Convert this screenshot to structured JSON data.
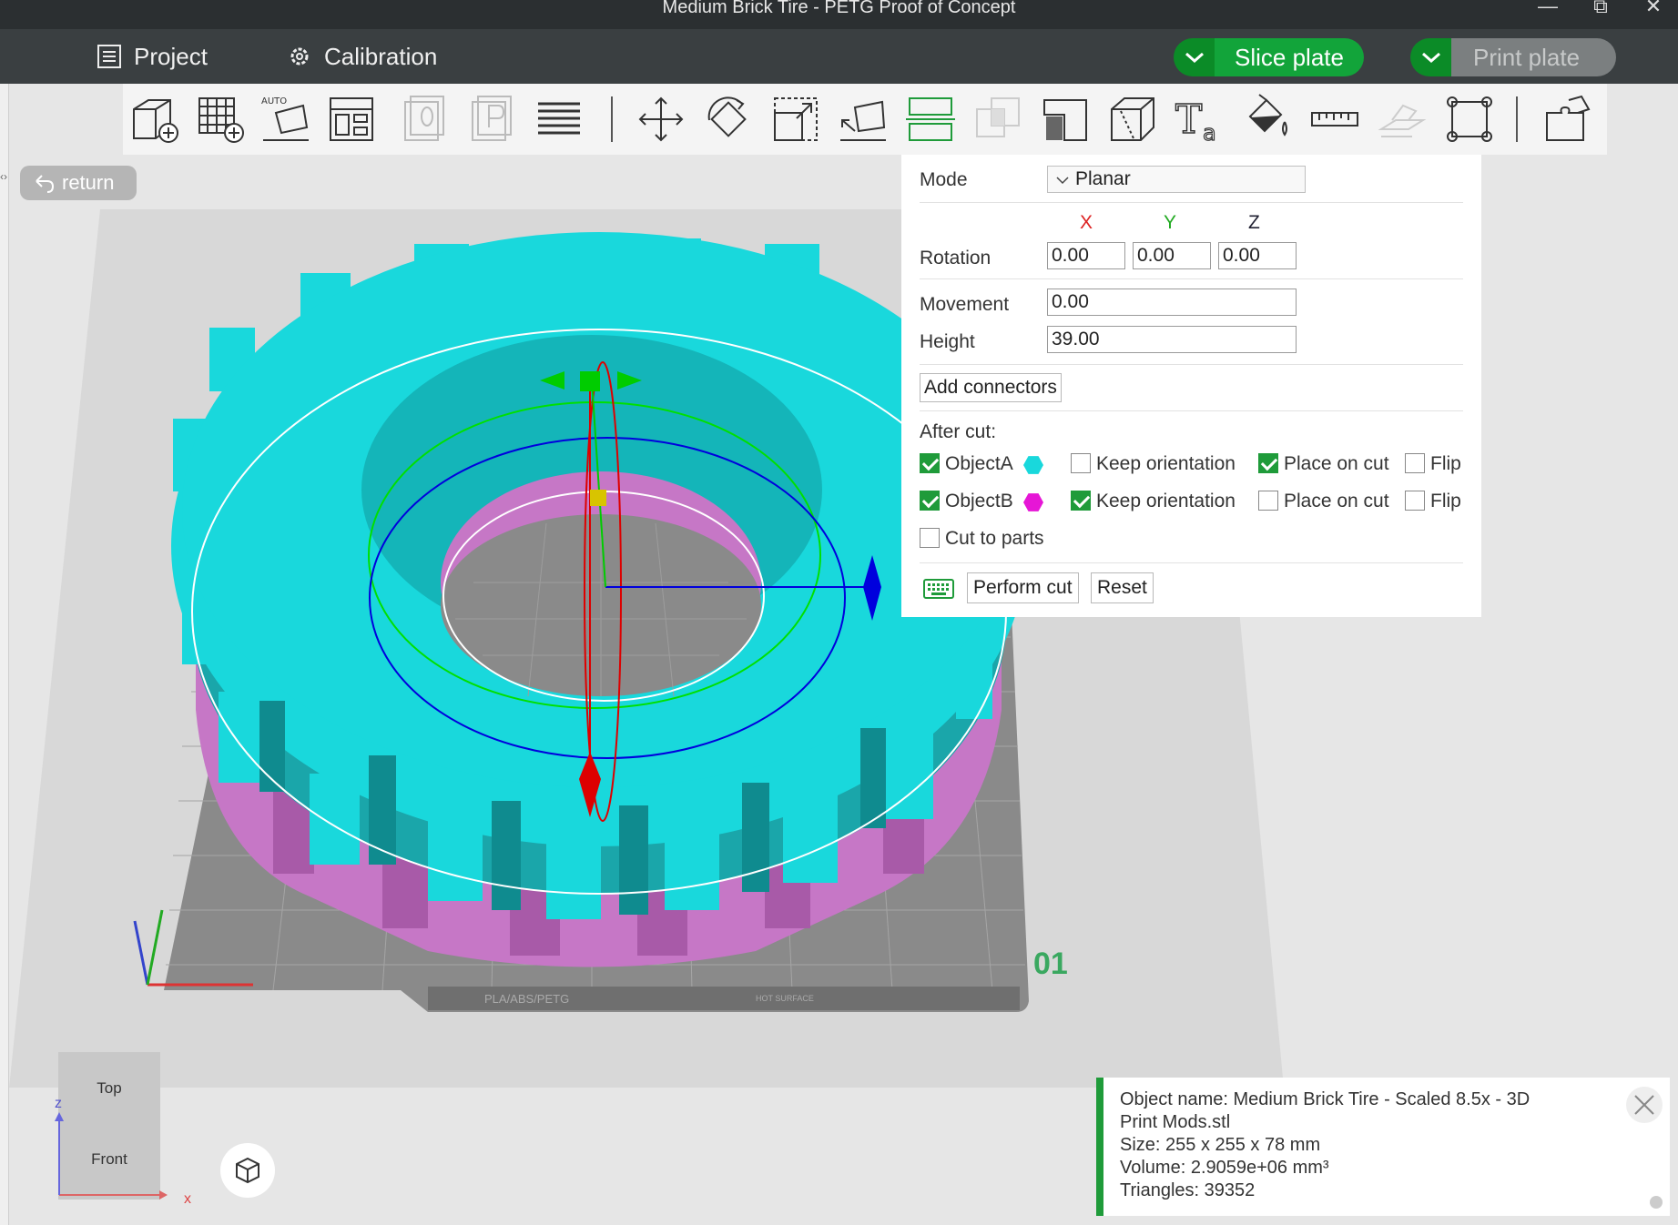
{
  "window": {
    "title": "Medium Brick Tire - PETG Proof of Concept"
  },
  "menubar": {
    "project": "Project",
    "calibration": "Calibration",
    "slice_plate": "Slice plate",
    "print_plate": "Print plate"
  },
  "return_label": "return",
  "cut_panel": {
    "mode_label": "Mode",
    "mode_value": "Planar",
    "axis_x": "X",
    "axis_y": "Y",
    "axis_z": "Z",
    "rotation_label": "Rotation",
    "rotation_x": "0.00",
    "rotation_y": "0.00",
    "rotation_z": "0.00",
    "movement_label": "Movement",
    "movement_value": "0.00",
    "height_label": "Height",
    "height_value": "39.00",
    "add_connectors": "Add connectors",
    "after_cut": "After cut:",
    "object_a": "ObjectA",
    "object_b": "ObjectB",
    "keep_orientation": "Keep orientation",
    "place_on_cut": "Place on cut",
    "flip": "Flip",
    "cut_to_parts": "Cut to parts",
    "perform_cut": "Perform cut",
    "reset": "Reset",
    "object_a_color": "#19d8dc",
    "object_b_color": "#e616d6",
    "checks": {
      "object_a": true,
      "a_keep_orientation": false,
      "a_place_on_cut": true,
      "a_flip": false,
      "object_b": true,
      "b_keep_orientation": true,
      "b_place_on_cut": false,
      "b_flip": false,
      "cut_to_parts": false
    }
  },
  "plate": {
    "number": "01",
    "label": "PLA/ABS/PETG",
    "surface": "HOT SURFACE"
  },
  "info": {
    "name_line1": "Object name: Medium Brick Tire - Scaled 8.5x - 3D",
    "name_line2": "Print Mods.stl",
    "size": "Size: 255 x 255 x 78 mm",
    "volume": "Volume: 2.9059e+06 mm³",
    "triangles": "Triangles: 39352"
  },
  "view_cube": {
    "top": "Top",
    "front": "Front",
    "axis_x": "x",
    "axis_z": "z"
  },
  "colors": {
    "accent": "#1f9b3a",
    "tire_top": "#19d8dc",
    "tire_side": "#1aa6aa",
    "tire_bottom": "#c878c8",
    "plate": "#8a8a8a"
  }
}
